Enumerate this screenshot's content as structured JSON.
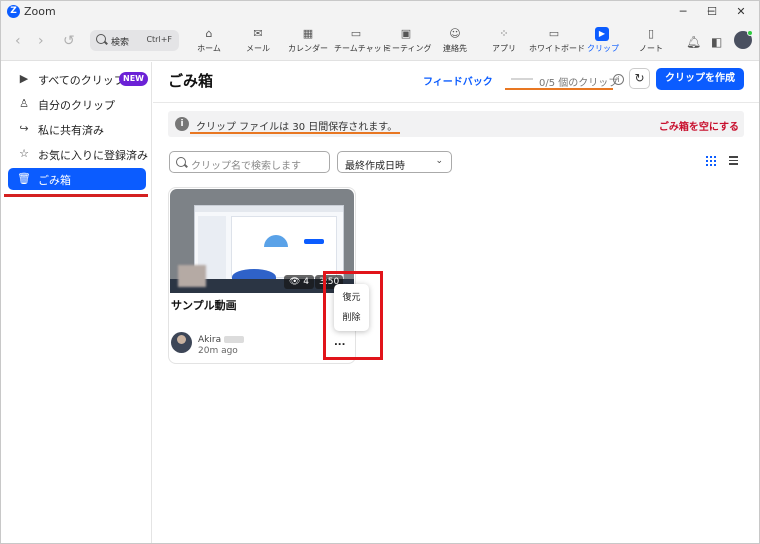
{
  "window": {
    "title": "Zoom",
    "logo_letter": "Z",
    "controls": {
      "minimize": "─",
      "maximize": "☐",
      "close": "✕"
    }
  },
  "toolbar": {
    "search": {
      "label": "検索",
      "shortcut": "Ctrl+F"
    },
    "nav": [
      {
        "label": "ホーム",
        "icon": "home-icon"
      },
      {
        "label": "メール",
        "icon": "mail-icon"
      },
      {
        "label": "カレンダー",
        "icon": "calendar-icon"
      },
      {
        "label": "チームチャット",
        "icon": "chat-icon"
      },
      {
        "label": "ミーティング",
        "icon": "video-icon"
      },
      {
        "label": "連絡先",
        "icon": "contacts-icon"
      },
      {
        "label": "アプリ",
        "icon": "apps-icon"
      },
      {
        "label": "ホワイトボード",
        "icon": "whiteboard-icon"
      },
      {
        "label": "クリップ",
        "icon": "clips-icon",
        "active": true
      },
      {
        "label": "ノート",
        "icon": "notes-icon"
      }
    ]
  },
  "sidebar": {
    "items": [
      {
        "label": "すべてのクリップ",
        "icon": "play-box-icon",
        "badge": "NEW"
      },
      {
        "label": "自分のクリップ",
        "icon": "person-icon"
      },
      {
        "label": "私に共有済み",
        "icon": "share-arrow-icon"
      },
      {
        "label": "お気に入りに登録済み",
        "icon": "star-icon"
      },
      {
        "label": "ごみ箱",
        "icon": "trash-icon",
        "active": true
      }
    ]
  },
  "main": {
    "title": "ごみ箱",
    "feedback": "フィードバック",
    "clip_count": "0/5 個のクリップ",
    "create_button": "クリップを作成",
    "banner": {
      "text": "クリップ ファイルは 30 日間保存されます。",
      "empty_trash": "ごみ箱を空にする"
    },
    "search_placeholder": "クリップ名で検索します",
    "sort": {
      "selected": "最終作成日時"
    },
    "clips": [
      {
        "title": "サンプル動画",
        "views": "4",
        "duration": "3:50",
        "owner": "Akira",
        "time": "20m ago"
      }
    ],
    "context_menu": {
      "restore": "復元",
      "delete": "削除"
    },
    "more_label": "..."
  },
  "colors": {
    "accent": "#0b5cff",
    "danger": "#c8102e",
    "annotation_red": "#e1141a",
    "annotation_orange": "#e87722",
    "badge_new": "#6b21d6"
  }
}
